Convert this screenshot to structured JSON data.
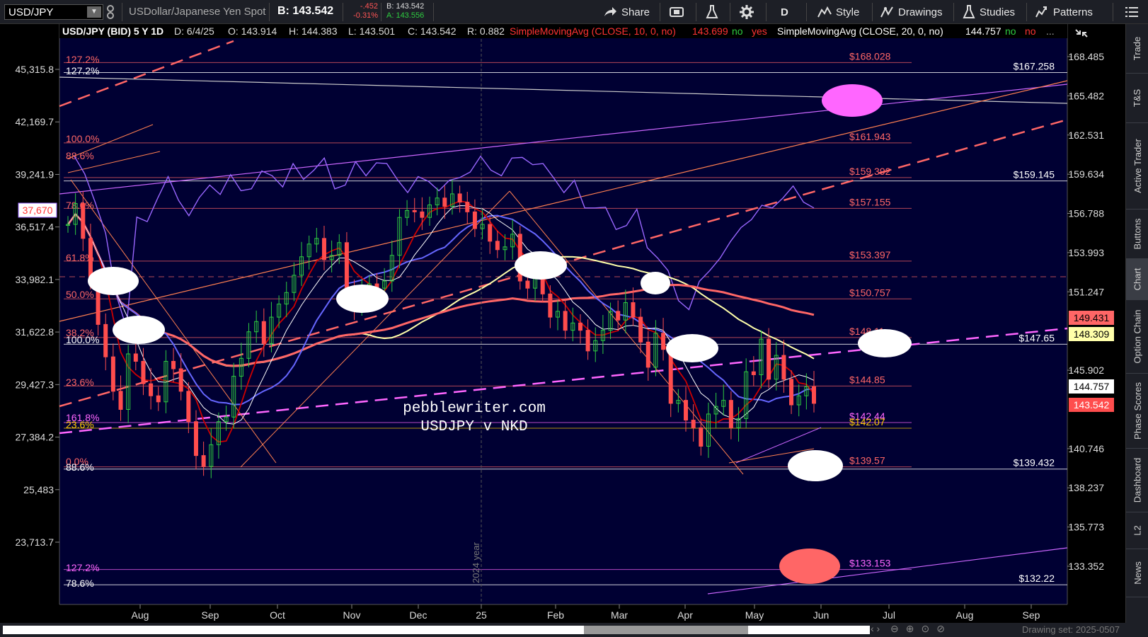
{
  "toolbar": {
    "symbol": "USD/JPY",
    "description": "USDollar/Japanese Yen Spot",
    "bid_label": "B: 143.542",
    "change": "-.452",
    "change_pct": "-0.31%",
    "bid_small": "B: 143.542",
    "ask_small": "A: 143.556",
    "share": "Share",
    "period": "D",
    "style": "Style",
    "drawings": "Drawings",
    "studies": "Studies",
    "patterns": "Patterns",
    "icons": [
      "link-icon",
      "share-icon",
      "screenshot-icon",
      "flask-icon",
      "gear-icon",
      "style-icon",
      "drawings-icon",
      "studies-icon",
      "patterns-icon",
      "menu-icon"
    ]
  },
  "header": {
    "title": "USD/JPY (BID) 5 Y 1D",
    "date": "D: 6/4/25",
    "open": "O: 143.914",
    "high": "H: 144.383",
    "low": "L: 143.501",
    "close": "C: 143.542",
    "range": "R: 0.882",
    "sma10": "SimpleMovingAvg (CLOSE, 10, 0, no)",
    "sma10_val": "143.699",
    "sma20": "SimpleMovingAvg (CLOSE, 20, 0, no)",
    "sma20_val": "144.757",
    "no": "no",
    "yes": "yes",
    "no2": "no",
    "no3": "no",
    "more": "..."
  },
  "right_tabs": [
    "Trade",
    "T&S",
    "Active Trader",
    "Buttons",
    "Chart",
    "Option Chain",
    "Phase Scores",
    "Dashboard",
    "L2",
    "News"
  ],
  "right_tabs_active": "Chart",
  "watermark": {
    "line1": "pebblewriter.com",
    "line2": "USDJPY v NKD"
  },
  "year_marker": "2024 year",
  "status": {
    "drawing_set": "Drawing set: 2025-0507"
  },
  "colors": {
    "background": "#000033",
    "price_up": "#2ecc40",
    "price_down": "#ff4d4d",
    "nikkei": "#9966ff",
    "fib_red": "#ff6666",
    "fib_white": "#ffffff",
    "sma_yellow": "#ffffaa",
    "sma_blue": "#6666ff",
    "sma_red": "#cc0000",
    "sma_salmon": "#ff6666",
    "pink": "#ff66ff",
    "orange": "#ff7f50"
  },
  "chart_data": {
    "type": "candlestick",
    "symbol": "USD/JPY",
    "overlay": "NKD",
    "x_labels": [
      "Aug",
      "Sep",
      "Oct",
      "Nov",
      "Dec",
      "25",
      "Feb",
      "Mar",
      "Apr",
      "May",
      "Jun",
      "Jul",
      "Aug",
      "Sep"
    ],
    "y_right_ticks": [
      "168.485",
      "165.482",
      "162.531",
      "159.634",
      "156.788",
      "153.993",
      "151.247",
      "145.902",
      "140.746",
      "138.237",
      "135.773",
      "133.352"
    ],
    "y_left_ticks": [
      "45,315.8",
      "42,169.7",
      "39,241.9",
      "36,517.4",
      "33,982.1",
      "31,622.8",
      "29,427.3",
      "27,384.2",
      "25,483",
      "23,713.7"
    ],
    "left_current": "37,670",
    "right_badges": [
      {
        "value": "149.431",
        "bg": "#ff6666",
        "fg": "#000"
      },
      {
        "value": "148.309",
        "bg": "#ffffaa",
        "fg": "#000"
      },
      {
        "value": "144.757",
        "bg": "#ffffff",
        "fg": "#000"
      },
      {
        "value": "143.542",
        "bg": "#ff4d4d",
        "fg": "#fff"
      }
    ],
    "price_series_close": [
      156.0,
      157.5,
      155.0,
      152.0,
      149.0,
      146.8,
      144.5,
      143.3,
      147.0,
      146.5,
      145.0,
      144.2,
      143.8,
      146.5,
      146.0,
      144.5,
      142.5,
      140.3,
      139.6,
      141.0,
      142.5,
      142.8,
      145.5,
      146.7,
      148.5,
      149.2,
      147.7,
      149.5,
      150.4,
      151.2,
      152.4,
      153.7,
      154.6,
      155.0,
      153.5,
      153.8,
      154.7,
      151.2,
      150.2,
      151.1,
      151.8,
      151.5,
      152.0,
      153.8,
      156.5,
      157.0,
      156.9,
      156.5,
      157.4,
      157.9,
      157.3,
      158.2,
      157.6,
      156.9,
      155.7,
      156.0,
      154.8,
      154.2,
      154.4,
      155.3,
      152.0,
      151.5,
      152.6,
      151.1,
      149.5,
      149.9,
      148.6,
      149.1,
      148.6,
      147.2,
      147.9,
      148.6,
      149.9,
      149.3,
      150.5,
      149.5,
      147.8,
      146.1,
      148.4,
      147.3,
      143.7,
      143.9,
      142.6,
      142.1,
      140.9,
      143.0,
      143.5,
      143.9,
      142.1,
      142.7,
      145.8,
      145.6,
      148.0,
      145.3,
      146.9,
      145.3,
      143.6,
      144.2,
      144.8,
      143.7
    ],
    "nikkei_series": [
      40000,
      39500,
      38000,
      36000,
      33500,
      32000,
      36800,
      37000,
      38200,
      38900,
      38100,
      37300,
      37800,
      38900,
      38400,
      39000,
      38600,
      38700,
      39200,
      39400,
      38800,
      39600,
      39200,
      39700,
      39900,
      38700,
      38900,
      39700,
      39400,
      40100,
      39600,
      39200,
      38500,
      38900,
      39100,
      38600,
      38700,
      39300,
      39600,
      40000,
      39700,
      39400,
      39900,
      40400,
      40000,
      39600,
      39300,
      38500,
      38700,
      37700,
      37700,
      37300,
      36600,
      36800,
      37200,
      35700,
      35200,
      34200,
      33200,
      32800,
      33700,
      34600,
      35200,
      35600,
      36700,
      37100,
      37400,
      37700,
      38200,
      38400,
      38000,
      37700
    ],
    "fib_levels_right": [
      {
        "label": "$168.028",
        "color": "#ff6666"
      },
      {
        "label": "$167.258",
        "color": "#ffffff"
      },
      {
        "label": "$161.943",
        "color": "#ff6666"
      },
      {
        "label": "$159.392",
        "color": "#ff6666"
      },
      {
        "label": "$159.145",
        "color": "#ffffff"
      },
      {
        "label": "$157.155",
        "color": "#ff6666"
      },
      {
        "label": "$153.397",
        "color": "#ff6666"
      },
      {
        "label": "$150.757",
        "color": "#ff6666"
      },
      {
        "label": "$148.11",
        "color": "#ff6666"
      },
      {
        "label": "$147.65",
        "color": "#ffffff"
      },
      {
        "label": "$144.85",
        "color": "#ff6666"
      },
      {
        "label": "$142.44",
        "color": "#ff66ff"
      },
      {
        "label": "$142.07",
        "color": "#ffcc00"
      },
      {
        "label": "$139.57",
        "color": "#ff6666"
      },
      {
        "label": "$139.432",
        "color": "#ffffff"
      },
      {
        "label": "$133.153",
        "color": "#ff66ff"
      },
      {
        "label": "$132.22",
        "color": "#ffffff"
      }
    ],
    "fib_levels_left": [
      {
        "label": "127.2%",
        "color": "#ff6666"
      },
      {
        "label": "127.2%",
        "color": "#ffffff"
      },
      {
        "label": "100.0%",
        "color": "#ff6666"
      },
      {
        "label": "88.6%",
        "color": "#ff6666"
      },
      {
        "label": "78.6%",
        "color": "#ff6666"
      },
      {
        "label": "61.8%",
        "color": "#ff6666"
      },
      {
        "label": "50.0%",
        "color": "#ff6666"
      },
      {
        "label": "38.2%",
        "color": "#ff6666"
      },
      {
        "label": "100.0%",
        "color": "#ffffff"
      },
      {
        "label": "23.6%",
        "color": "#ff6666"
      },
      {
        "label": "161.8%",
        "color": "#ff66ff"
      },
      {
        "label": "23.6%",
        "color": "#ffcc00"
      },
      {
        "label": "0.0%",
        "color": "#ff6666"
      },
      {
        "label": "88.6%",
        "color": "#ffffff"
      },
      {
        "label": "127.2%",
        "color": "#ff66ff"
      },
      {
        "label": "78.6%",
        "color": "#ffffff"
      }
    ]
  }
}
